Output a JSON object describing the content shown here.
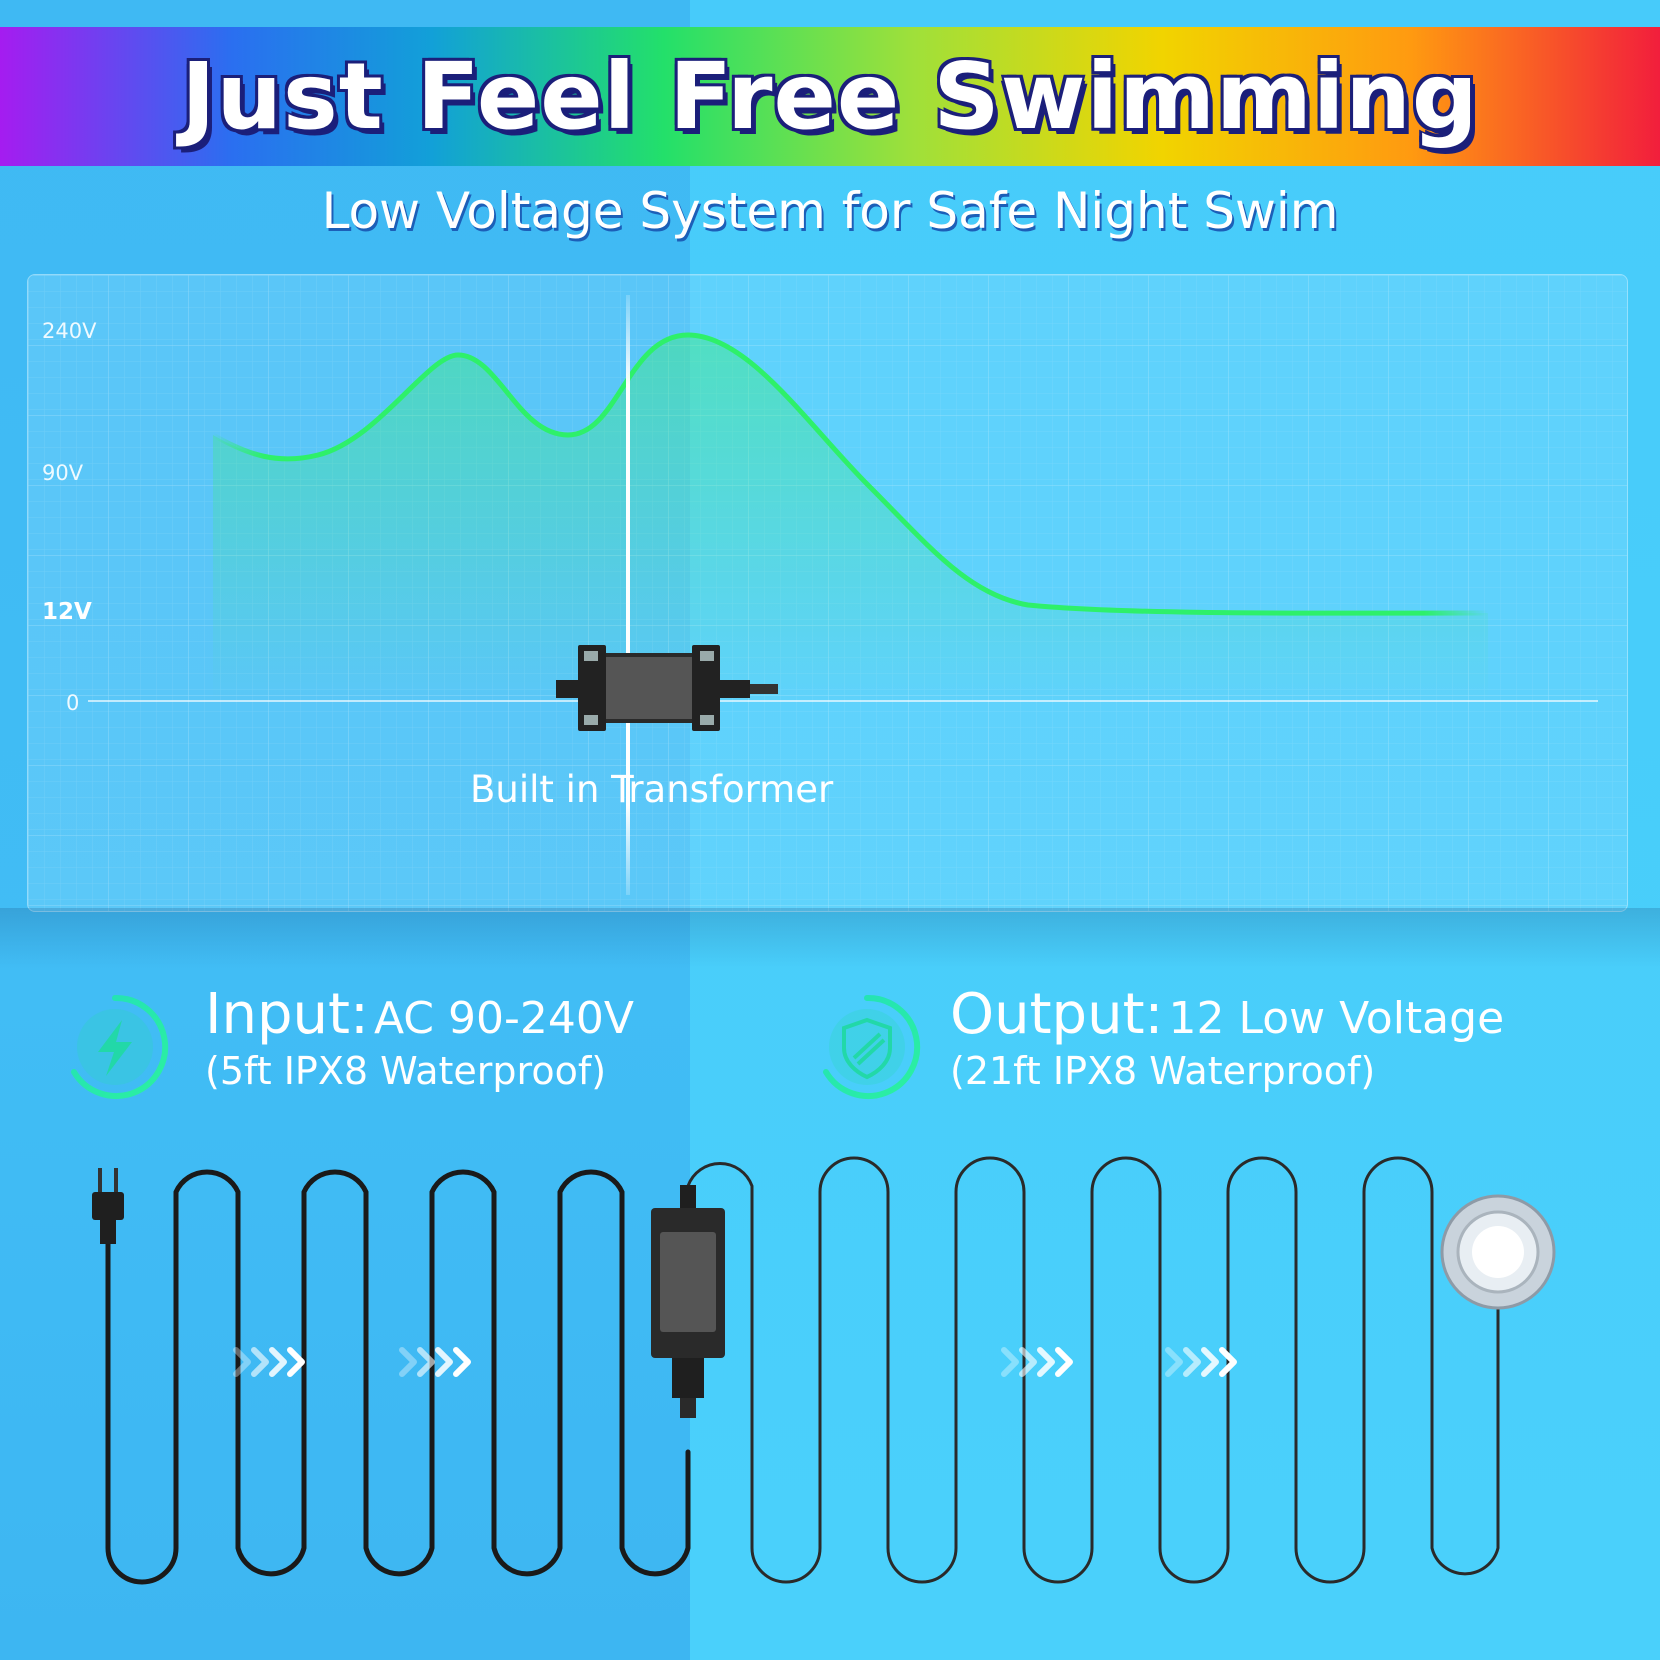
{
  "header": {
    "title": "Just Feel Free Swimming",
    "subtitle": "Low Voltage System for Safe Night Swim"
  },
  "chart": {
    "y_tick_labels": [
      "240V",
      "90V",
      "12V",
      "0"
    ],
    "transformer_caption": "Built in Transformer"
  },
  "chart_data": {
    "type": "line",
    "title": "",
    "xlabel": "",
    "ylabel": "",
    "y_ticks": [
      "240V",
      "90V",
      "12V",
      "0"
    ],
    "series": [
      {
        "values_before_transformer": "AC 90-240V fluctuating",
        "values_after_transformer": "12V constant"
      }
    ],
    "grid": true
  },
  "specs": {
    "input": {
      "label": "Input:",
      "value": "AC 90-240V",
      "detail": "(5ft IPX8 Waterproof)",
      "icon": "lightning-bolt-icon"
    },
    "output": {
      "label": "Output:",
      "value": "12 Low Voltage",
      "detail": "(21ft IPX8 Waterproof)",
      "icon": "shield-icon"
    }
  },
  "colors": {
    "background": "#45c8f8",
    "curve": "#2ef06a",
    "icon_ring": "#2ee0b0",
    "cable": "#1a1a1a"
  }
}
